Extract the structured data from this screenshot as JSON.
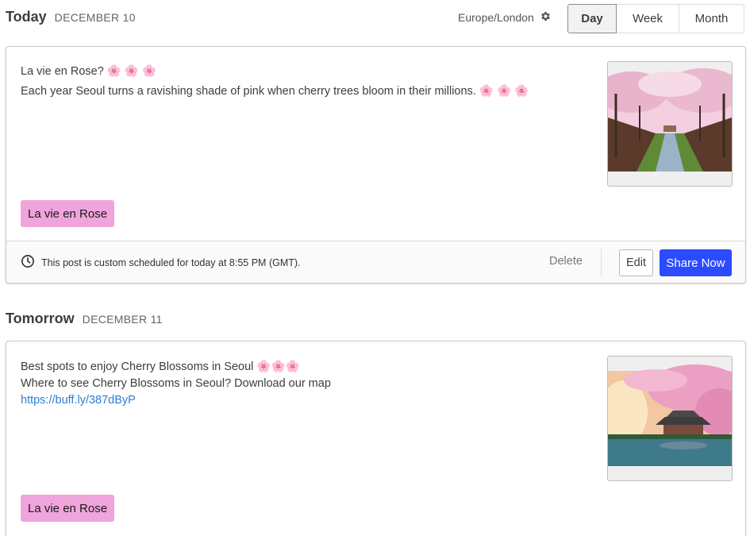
{
  "today": {
    "title": "Today",
    "date": "DECEMBER 10",
    "post": {
      "line1": "La vie en Rose? 🌸 🌸 🌸",
      "line2": "Each year Seoul turns a ravishing shade of pink when cherry trees bloom in their millions. 🌸 🌸 🌸",
      "tag": "La vie en Rose",
      "schedule_text": "This post is custom scheduled for today at 8:55 PM (GMT).",
      "delete_label": "Delete",
      "edit_label": "Edit",
      "share_label": "Share Now"
    }
  },
  "timezone": {
    "label": "Europe/London",
    "icon": "gear-icon"
  },
  "views": {
    "day": "Day",
    "week": "Week",
    "month": "Month",
    "active": "Day"
  },
  "tomorrow": {
    "title": "Tomorrow",
    "date": "DECEMBER 11",
    "post": {
      "line1": "Best spots to enjoy Cherry Blossoms in Seoul 🌸🌸🌸",
      "line2": "Where to see Cherry Blossoms in Seoul? Download our map",
      "link": "https://buff.ly/387dByP",
      "tag": "La vie en Rose"
    }
  },
  "colors": {
    "accent": "#2c4bff",
    "tag": "#f0a4dc",
    "link": "#2c7fd6"
  }
}
